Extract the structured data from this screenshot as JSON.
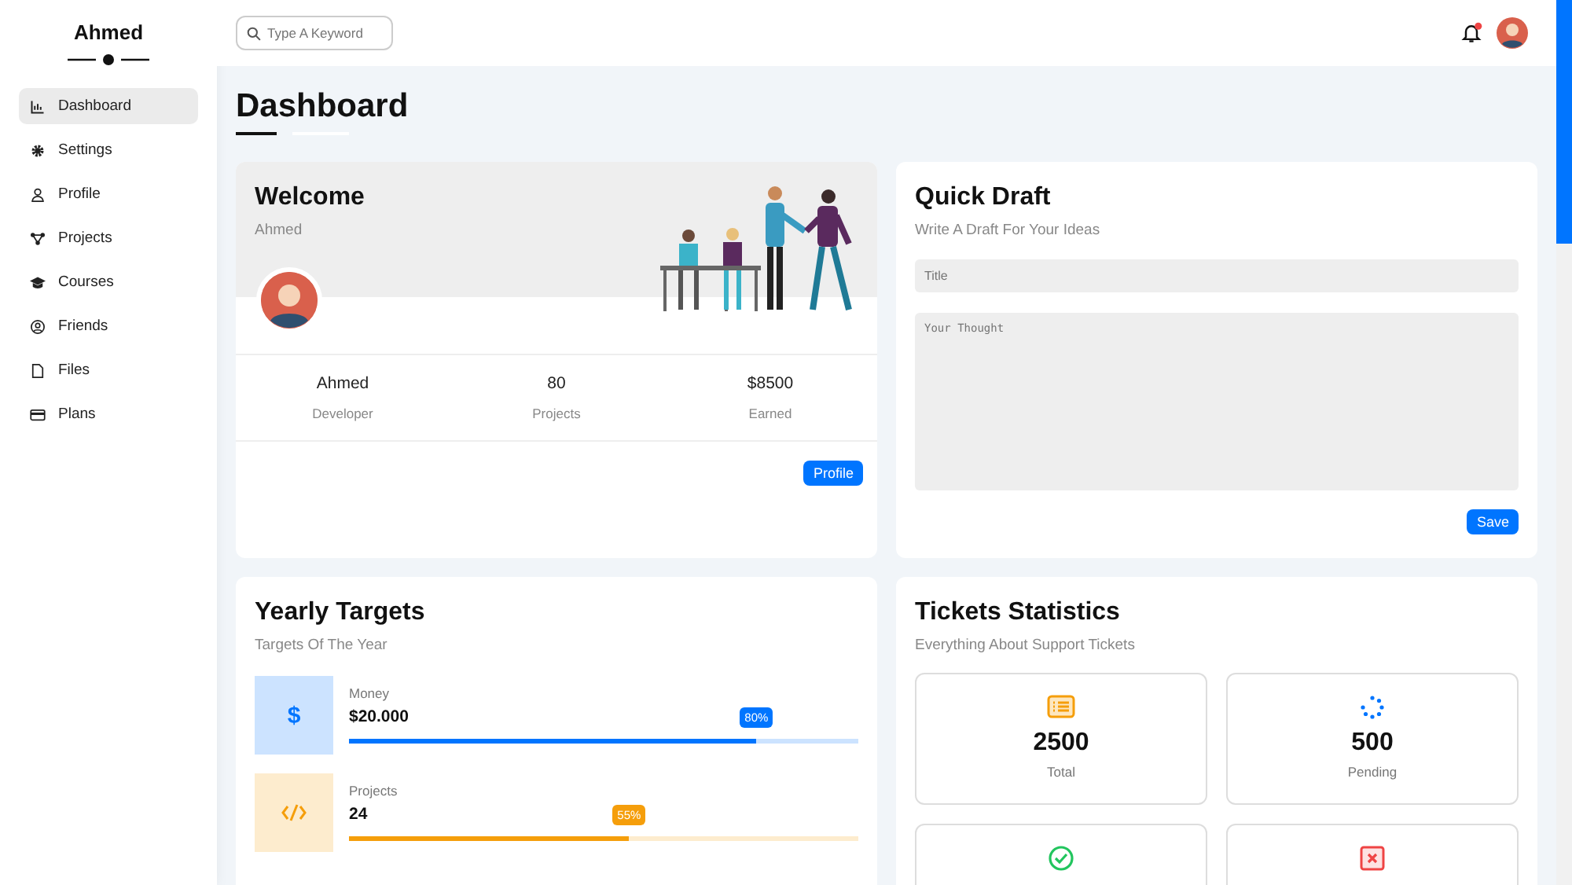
{
  "sidebar": {
    "title": "Ahmed",
    "items": [
      {
        "label": "Dashboard",
        "selected": true
      },
      {
        "label": "Settings",
        "selected": false
      },
      {
        "label": "Profile",
        "selected": false
      },
      {
        "label": "Projects",
        "selected": false
      },
      {
        "label": "Courses",
        "selected": false
      },
      {
        "label": "Friends",
        "selected": false
      },
      {
        "label": "Files",
        "selected": false
      },
      {
        "label": "Plans",
        "selected": false
      }
    ]
  },
  "header": {
    "search": {
      "placeholder": "Type A Keyword"
    }
  },
  "page_title": "Dashboard",
  "welcome": {
    "title": "Welcome",
    "subtitle": "Ahmed",
    "stats": [
      {
        "value": "Ahmed",
        "label": "Developer"
      },
      {
        "value": "80",
        "label": "Projects"
      },
      {
        "value": "$8500",
        "label": "Earned"
      }
    ],
    "button": "Profile"
  },
  "quick_draft": {
    "title": "Quick Draft",
    "subtitle": "Write A Draft For Your Ideas",
    "title_field": {
      "placeholder": "Title"
    },
    "body_field": {
      "placeholder": "Your Thought"
    },
    "button": "Save"
  },
  "yearly_targets": {
    "title": "Yearly Targets",
    "subtitle": "Targets Of The Year",
    "targets": [
      {
        "symbol": "$",
        "label": "Money",
        "value": "$20.000",
        "level": 0.8,
        "percent": "80%",
        "color": "#0075ff"
      },
      {
        "label": "Projects",
        "value": "24",
        "level": 0.55,
        "percent": "55%",
        "color": "#f59e0b"
      }
    ]
  },
  "tickets": {
    "title": "Tickets Statistics",
    "subtitle": "Everything About Support Tickets",
    "stats": [
      {
        "kind": "total",
        "value": "2500",
        "label": "Total"
      },
      {
        "kind": "pending",
        "value": "500",
        "label": "Pending"
      },
      {
        "kind": "closed"
      },
      {
        "kind": "deleted"
      }
    ]
  }
}
